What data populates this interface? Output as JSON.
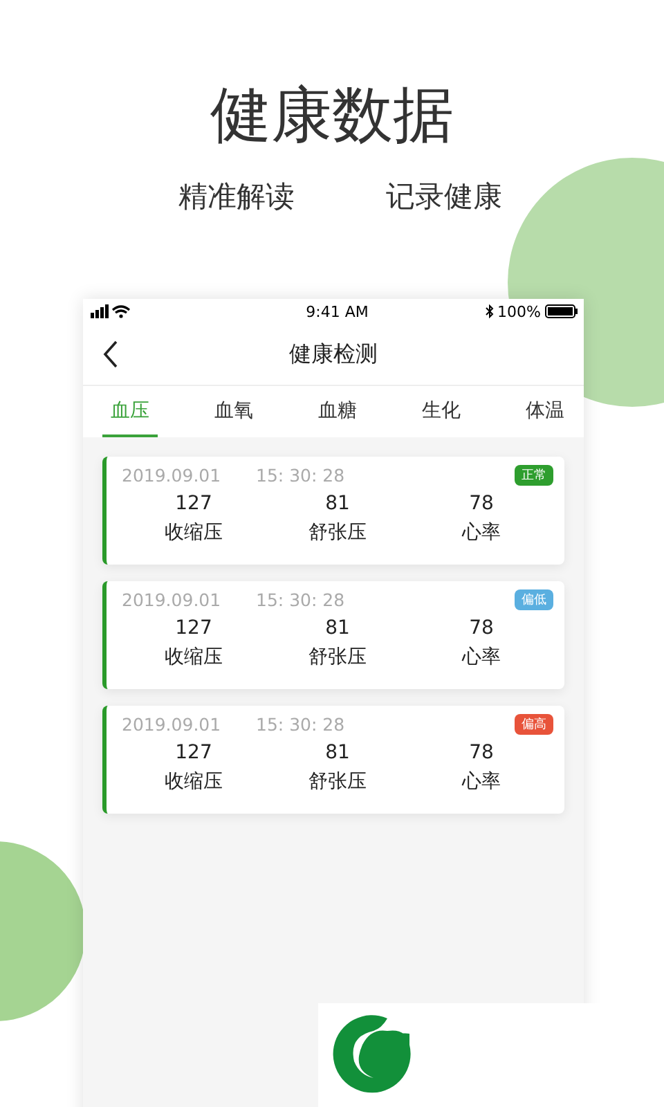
{
  "headline": "健康数据",
  "subtitles": [
    "精准解读",
    "记录健康"
  ],
  "phone": {
    "status_bar": {
      "time": "9:41 AM",
      "battery": "100%"
    },
    "nav": {
      "title": "健康检测"
    },
    "tabs": [
      {
        "label": "血压",
        "selected": true
      },
      {
        "label": "血氧",
        "selected": false
      },
      {
        "label": "血糖",
        "selected": false
      },
      {
        "label": "生化",
        "selected": false
      },
      {
        "label": "体温",
        "selected": false
      }
    ],
    "records": [
      {
        "date": "2019.09.01",
        "time": "15: 30: 28",
        "status": "正常",
        "color": "#2e9e2e",
        "values": [
          {
            "value": "127",
            "label": "收缩压"
          },
          {
            "value": "81",
            "label": "舒张压"
          },
          {
            "value": "78",
            "label": "心率"
          }
        ]
      },
      {
        "date": "2019.09.01",
        "time": "15: 30: 28",
        "status": "偏低",
        "color": "#5aafe0",
        "values": [
          {
            "value": "127",
            "label": "收缩压"
          },
          {
            "value": "81",
            "label": "舒张压"
          },
          {
            "value": "78",
            "label": "心率"
          }
        ]
      },
      {
        "date": "2019.09.01",
        "time": "15: 30: 28",
        "status": "偏高",
        "color": "#e8533a",
        "values": [
          {
            "value": "127",
            "label": "收缩压"
          },
          {
            "value": "81",
            "label": "舒张压"
          },
          {
            "value": "78",
            "label": "心率"
          }
        ]
      }
    ]
  }
}
